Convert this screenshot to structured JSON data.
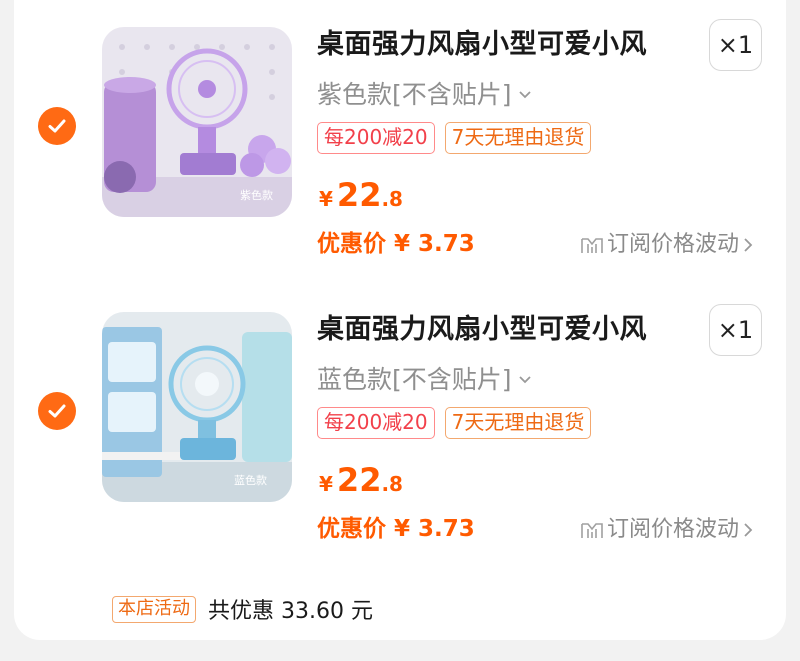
{
  "items": [
    {
      "title": "桌面强力风扇小型可爱小风",
      "quantity": "×1",
      "variant": "紫色款[不含贴片]",
      "tags": [
        "每200减20",
        "7天无理由退货"
      ],
      "price": {
        "currency": "¥",
        "integer": "22",
        "decimal": ".8"
      },
      "promo_price": "优惠价 ¥ 3.73",
      "subscribe_label": "订阅价格波动",
      "image_caption": "紫色款",
      "selected": true
    },
    {
      "title": "桌面强力风扇小型可爱小风",
      "quantity": "×1",
      "variant": "蓝色款[不含贴片]",
      "tags": [
        "每200减20",
        "7天无理由退货"
      ],
      "price": {
        "currency": "¥",
        "integer": "22",
        "decimal": ".8"
      },
      "promo_price": "优惠价 ¥ 3.73",
      "subscribe_label": "订阅价格波动",
      "image_caption": "蓝色款",
      "selected": true
    }
  ],
  "store_activity": {
    "tag": "本店活动",
    "text": "共优惠 33.60 元"
  },
  "colors": {
    "accent": "#ff5a00",
    "check": "#ff6a14",
    "discount_tag": "#f2404a",
    "return_tag": "#ee6a14"
  },
  "icons": [
    "checkmark-icon",
    "chevron-down-icon",
    "price-chart-icon",
    "chevron-right-icon"
  ]
}
